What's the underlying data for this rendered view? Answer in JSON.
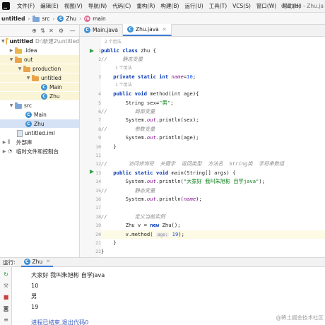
{
  "menubar": {
    "items": [
      "文件(F)",
      "编辑(E)",
      "视图(V)",
      "导航(N)",
      "代码(C)",
      "重构(R)",
      "构建(B)",
      "运行(U)",
      "工具(T)",
      "VCS(S)",
      "窗口(W)",
      "帮助(H)"
    ],
    "window_title": "untitled - Zhu.ja"
  },
  "navbar": {
    "project": "untitled",
    "folder": "src",
    "class": "Zhu",
    "method": "main"
  },
  "editor_tabs": [
    {
      "label": "Main.java",
      "active": false
    },
    {
      "label": "Zhu.java",
      "active": true
    }
  ],
  "project_tree": [
    {
      "label": "untitled",
      "path": "D:\\新建2\\untitled",
      "indent": 0,
      "icon": "folder",
      "expanded": true,
      "style": "root"
    },
    {
      "label": ".idea",
      "indent": 1,
      "icon": "folder",
      "expanded": false,
      "style": ""
    },
    {
      "label": "out",
      "indent": 1,
      "icon": "folder-orange",
      "expanded": true,
      "style": "excluded"
    },
    {
      "label": "production",
      "indent": 2,
      "icon": "folder-orange",
      "expanded": true,
      "style": "excluded"
    },
    {
      "label": "untitled",
      "indent": 3,
      "icon": "folder-orange",
      "expanded": true,
      "style": "excluded"
    },
    {
      "label": "Main",
      "indent": 4,
      "icon": "class",
      "expanded": null,
      "style": "excluded"
    },
    {
      "label": "Zhu",
      "indent": 4,
      "icon": "class",
      "expanded": null,
      "style": "excluded"
    },
    {
      "label": "src",
      "indent": 1,
      "icon": "folder-blue",
      "expanded": true,
      "style": ""
    },
    {
      "label": "Main",
      "indent": 2,
      "icon": "class",
      "expanded": null,
      "style": ""
    },
    {
      "label": "Zhu",
      "indent": 2,
      "icon": "class",
      "expanded": null,
      "style": "selected"
    },
    {
      "label": "untitled.iml",
      "indent": 1,
      "icon": "file",
      "expanded": null,
      "style": ""
    },
    {
      "label": "外部库",
      "indent": 0,
      "icon": "library",
      "expanded": false,
      "style": ""
    },
    {
      "label": "临时文件和控制台",
      "indent": 0,
      "icon": "console",
      "expanded": false,
      "style": ""
    }
  ],
  "code": {
    "usage_hint": "2 个用法",
    "usage_hint_1": "1 个用法",
    "line_numbers": [
      "1",
      "2",
      "3",
      "4",
      "5",
      "6",
      "7",
      "8",
      "9",
      "10",
      "11",
      "12",
      "13",
      "14",
      "15",
      "16",
      "17",
      "18",
      "19",
      "20",
      "21",
      "22"
    ],
    "l1_kw": "public class",
    "l1_name": " Zhu {",
    "l2_cmt": "//     静态变量",
    "l3_kw": "    private static int ",
    "l3_fld": "name",
    "l3_rest": "=",
    "l3_num": "10",
    "l3_end": ";",
    "l4_kw": "    public void ",
    "l4_rest": "method(int age){",
    "l5_a": "        String sex=",
    "l5_str": "\"男\"",
    "l5_b": ";",
    "l6_cmt": "//         局部变量",
    "l7_a": "        System.",
    "l7_out": "out",
    "l7_b": ".println(sex);",
    "l8_cmt": "//         参数变量",
    "l9_a": "        System.",
    "l9_out": "out",
    "l9_b": ".println(age);",
    "l10": "    }",
    "l11": "",
    "l12_cmt": "//       访问修饰符  关键字  返回类型  方法名  String类  字符串数组",
    "l13_kw": "    public static void ",
    "l13_rest": "main(String[] args) {",
    "l14_a": "        System.",
    "l14_out": "out",
    "l14_b": ".println(",
    "l14_str": "\"大家好 我叫朱旭彬 自学java\"",
    "l14_c": ");",
    "l15_cmt": "//         静态变量",
    "l16_a": "        System.",
    "l16_out": "out",
    "l16_b": ".println(",
    "l16_fld": "name",
    "l16_c": ");",
    "l17": "",
    "l18_cmt": "//         定义当前实例",
    "l19_a": "        Zhu v = ",
    "l19_kw": "new",
    "l19_b": " Zhu();",
    "l20_a": "        v.method( ",
    "l20_hint": "age:",
    "l20_num": " 19",
    "l20_b": ");",
    "l21": "    }",
    "l22": "}"
  },
  "run_panel": {
    "label": "运行:",
    "tab": "Zhu",
    "output": [
      "大家好 我叫朱旭彬 自学java",
      "10",
      "男",
      "19",
      "进程已结束,退出代码0"
    ]
  },
  "watermark": "@稀土掘金技术社区",
  "colors": {
    "keyword": "#0033b3",
    "string": "#067d17",
    "number": "#1750eb",
    "field": "#871094",
    "comment": "#8c8c8c",
    "selection": "#d5e1f4",
    "excluded": "#fbf5d8",
    "run_green": "#2f9e44"
  }
}
